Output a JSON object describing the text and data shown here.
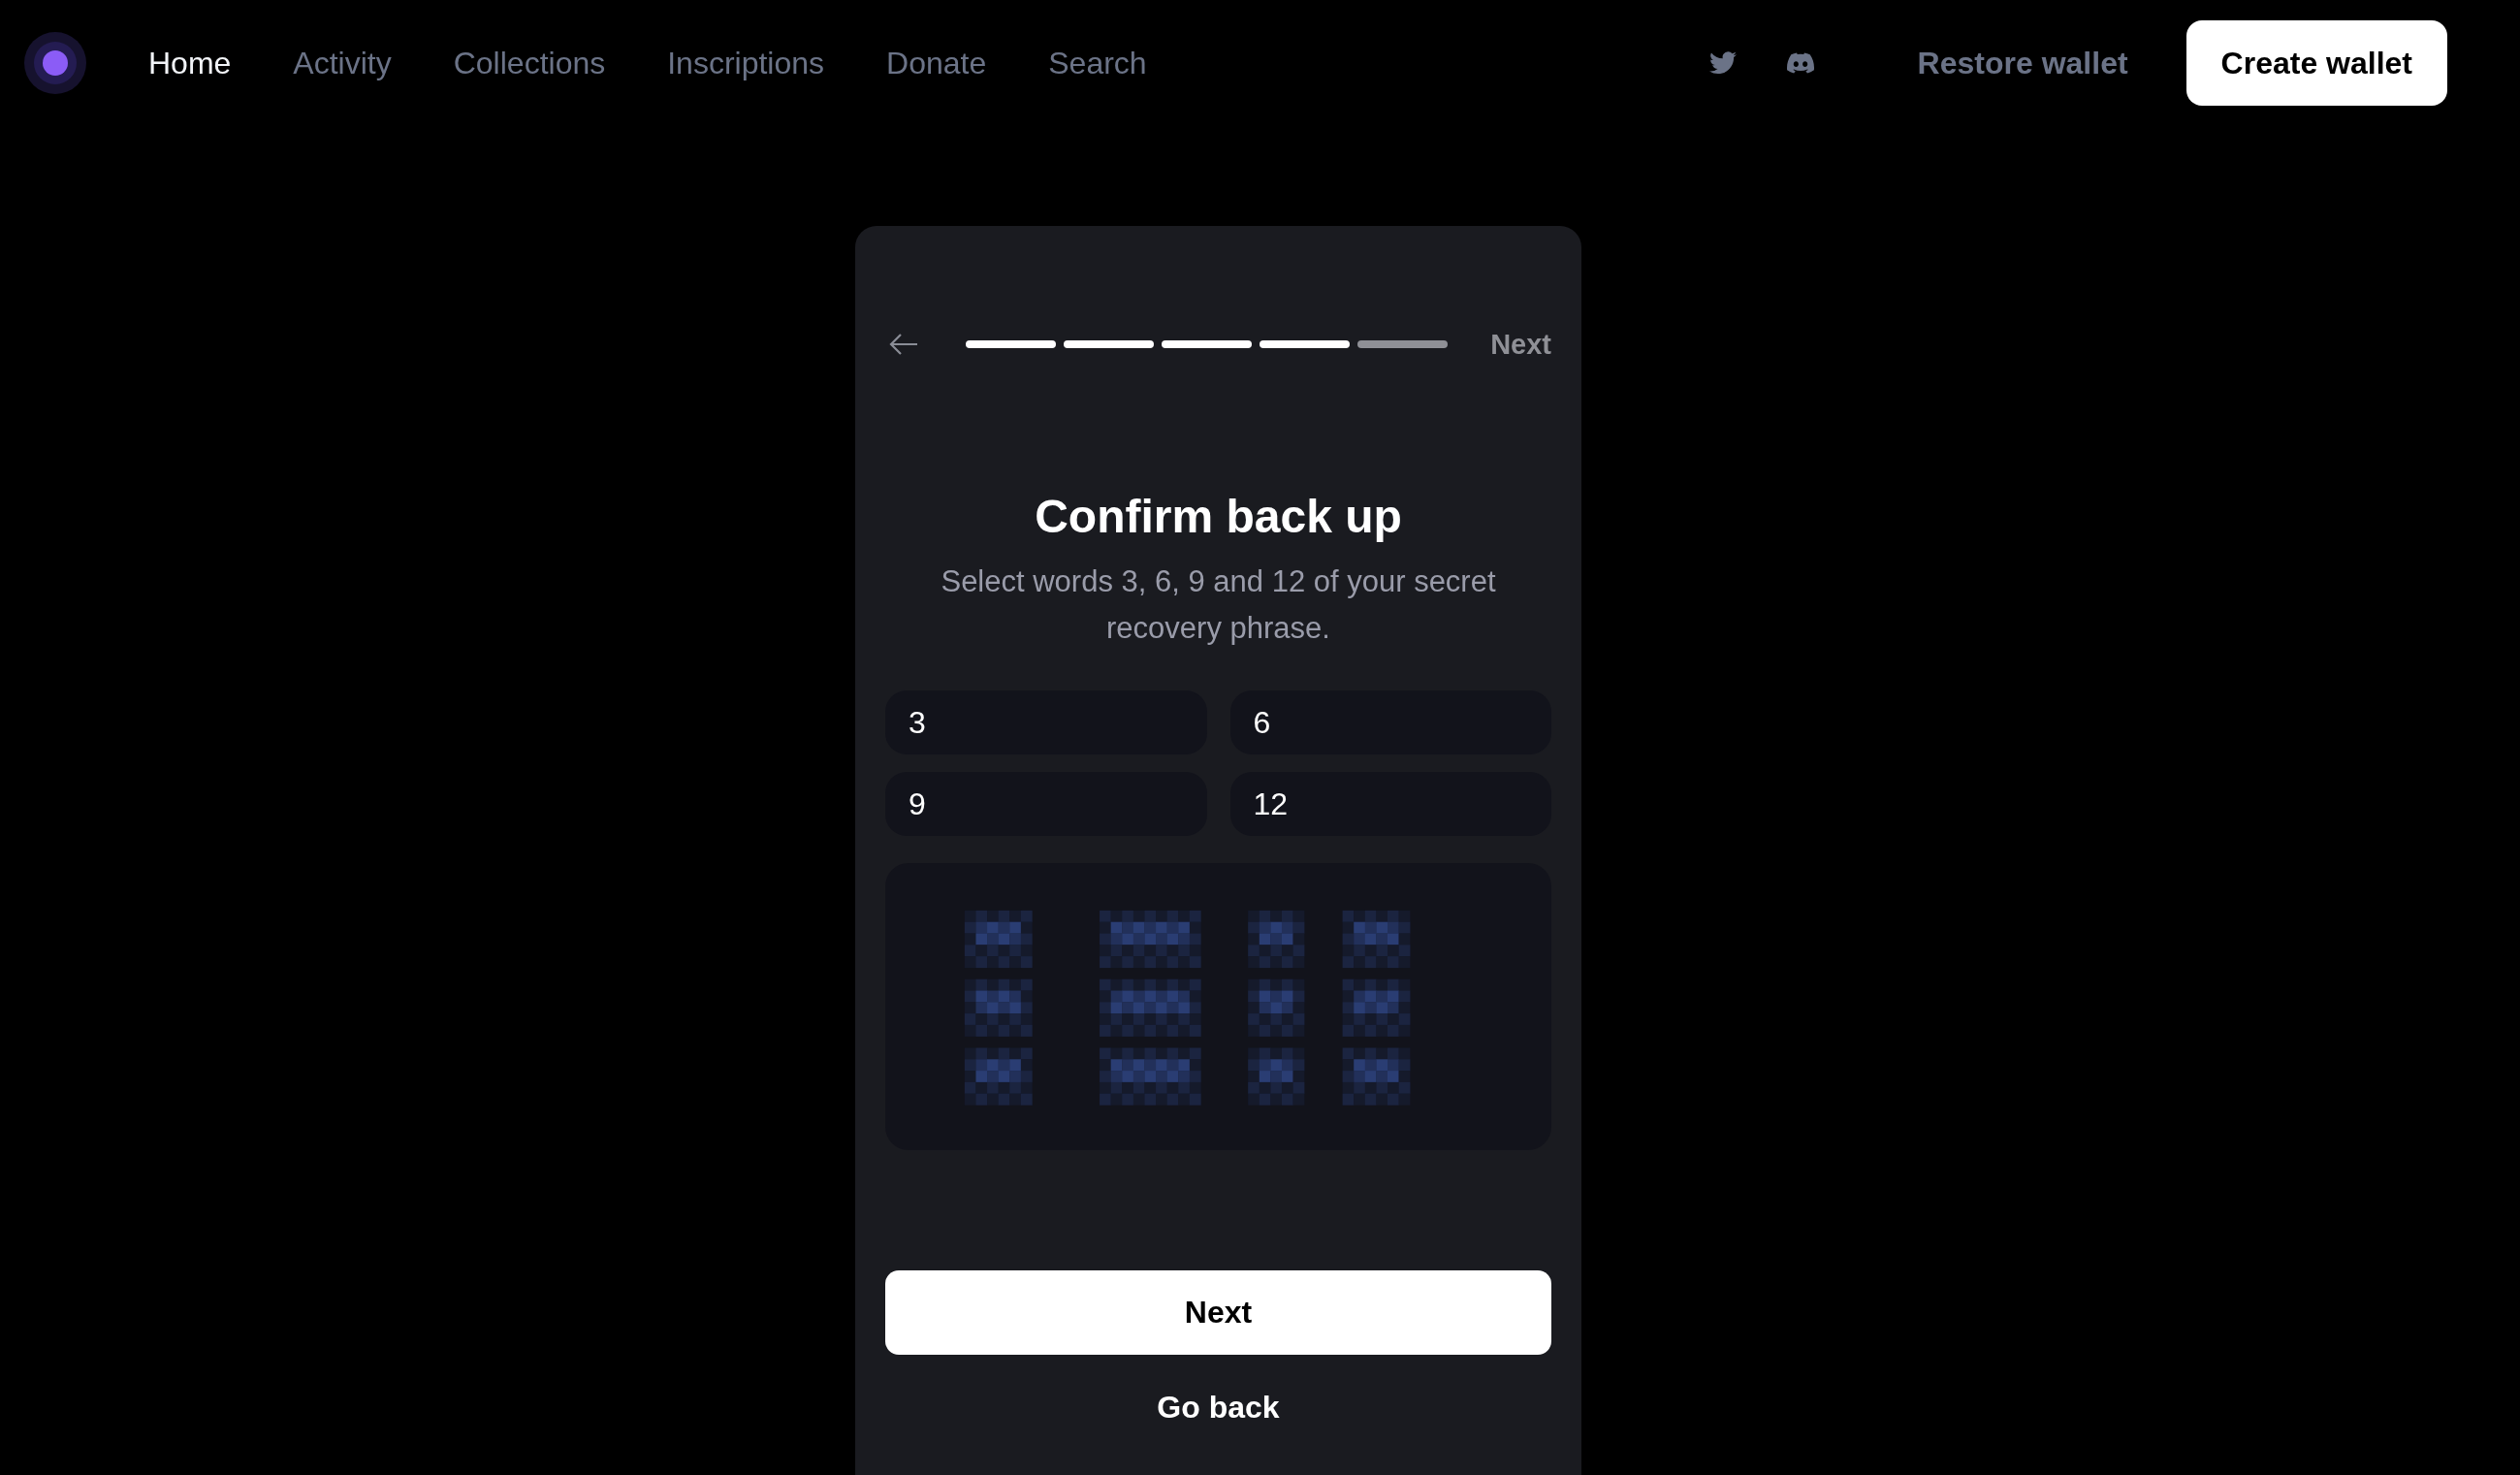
{
  "nav": {
    "items": [
      {
        "label": "Home",
        "selected": true
      },
      {
        "label": "Activity",
        "selected": false
      },
      {
        "label": "Collections",
        "selected": false
      },
      {
        "label": "Inscriptions",
        "selected": false
      },
      {
        "label": "Donate",
        "selected": false
      },
      {
        "label": "Search",
        "selected": false
      }
    ],
    "restore_button": "Restore wallet",
    "create_button": "Create wallet"
  },
  "card": {
    "header": {
      "next_link": "Next",
      "steps": [
        {
          "done": true
        },
        {
          "done": true
        },
        {
          "done": true
        },
        {
          "done": true
        },
        {
          "done": false
        }
      ]
    },
    "title": "Confirm back up",
    "subtitle": "Select words 3, 6, 9 and 12 of your secret recovery phrase.",
    "slots": [
      {
        "label": "3"
      },
      {
        "label": "6"
      },
      {
        "label": "9"
      },
      {
        "label": "12"
      }
    ],
    "next_button": "Next",
    "back_button": "Go back"
  }
}
